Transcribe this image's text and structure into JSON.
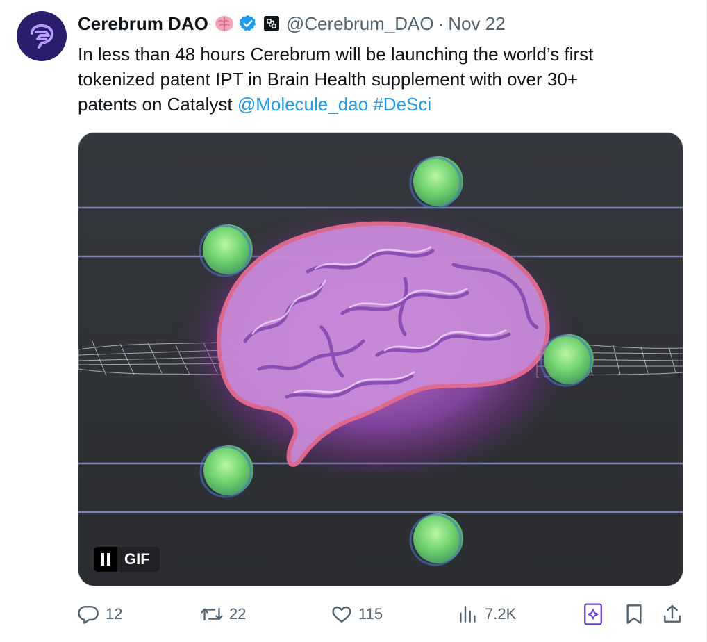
{
  "tweet": {
    "display_name": "Cerebrum DAO",
    "handle": "@Cerebrum_DAO",
    "separator": "·",
    "date": "Nov 22",
    "text_lines": [
      "In less than 48 hours Cerebrum will be launching the world’s first",
      "tokenized patent IPT in Brain Health supplement with over 30+",
      "patents on Catalyst "
    ],
    "mention": "@Molecule_dao",
    "hashtag": "#DeSci",
    "icons": {
      "avatar": "brain-logo-icon",
      "emoji": "brain-emoji-icon",
      "verified": "verified-badge-icon",
      "affiliate": "affiliate-badge-icon"
    }
  },
  "media": {
    "type": "gif",
    "badge_label": "GIF",
    "pause_icon": "pause-icon"
  },
  "actions": {
    "reply": {
      "icon": "reply-icon",
      "count": "12"
    },
    "retweet": {
      "icon": "retweet-icon",
      "count": "22"
    },
    "like": {
      "icon": "heart-icon",
      "count": "115"
    },
    "views": {
      "icon": "views-chart-icon",
      "count": "7.2K"
    },
    "grok": {
      "icon": "grok-icon"
    },
    "bookmark": {
      "icon": "bookmark-icon"
    },
    "share": {
      "icon": "share-icon"
    }
  },
  "colors": {
    "link": "#1d9bf0",
    "muted": "#536471",
    "verified": "#1d9bf0",
    "avatar_bg": "#2a1d6b",
    "grok_accent": "#6a3fd6"
  }
}
